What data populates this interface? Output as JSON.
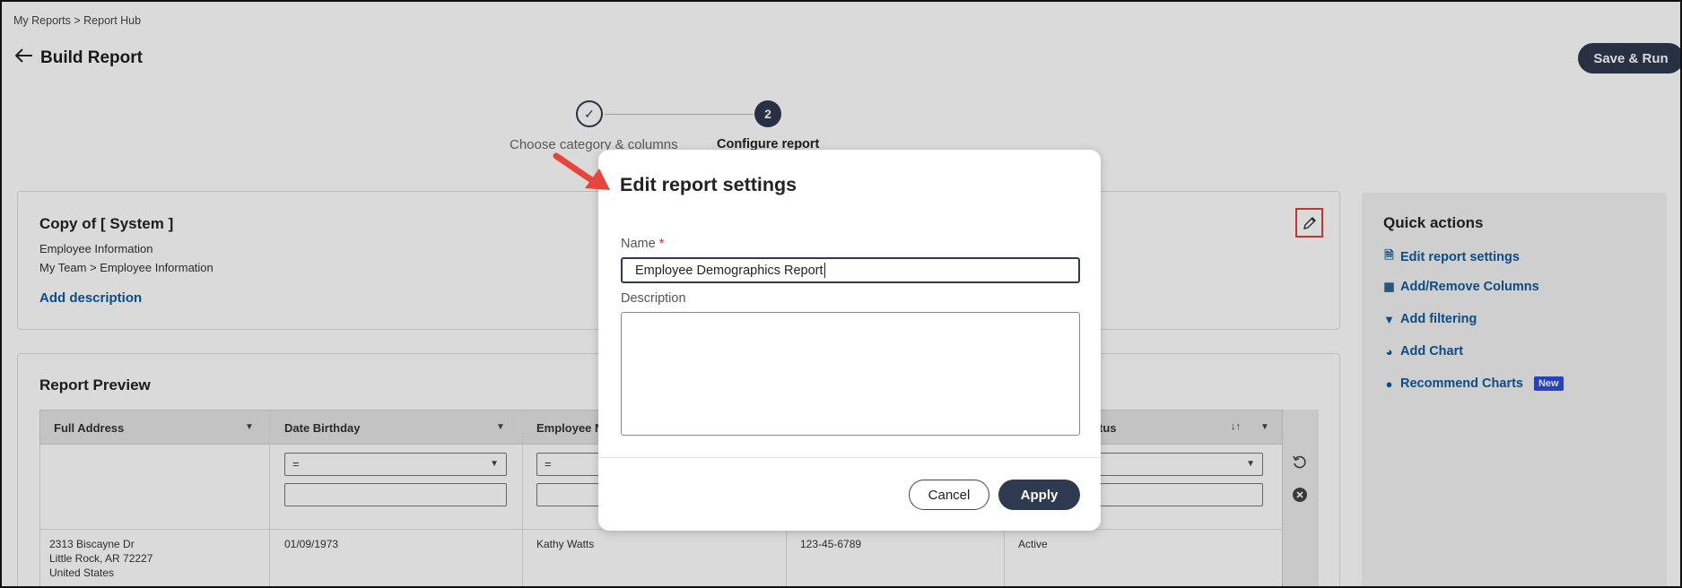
{
  "breadcrumb": "My Reports  >  Report Hub",
  "header": {
    "title": "Build Report",
    "save_run": "Save & Run"
  },
  "stepper": {
    "step1_label": "Choose category & columns",
    "step1_icon": "✓",
    "step2_number": "2",
    "step2_label": "Configure report"
  },
  "report_info": {
    "title": "Copy of [ System ]",
    "category": "Employee Information",
    "path": "My Team > Employee Information",
    "add_description": "Add description"
  },
  "quick_actions": {
    "title": "Quick actions",
    "items": [
      {
        "label": "Edit report settings",
        "icon": "document-icon"
      },
      {
        "label": "Add/Remove Columns",
        "icon": "columns-icon"
      },
      {
        "label": "Add filtering",
        "icon": "filter-icon"
      },
      {
        "label": "Add Chart",
        "icon": "pie-chart-icon"
      },
      {
        "label": "Recommend Charts",
        "icon": "lightbulb-icon",
        "badge": "New"
      }
    ]
  },
  "preview": {
    "title": "Report Preview",
    "columns": [
      "Full Address",
      "Date Birthday",
      "Employee Na",
      "tus"
    ],
    "filter_operator": "=",
    "row": {
      "address_line1": "2313 Biscayne Dr",
      "address_line2": "Little Rock, AR 72227",
      "address_line3": "United States",
      "birthday": "01/09/1973",
      "name": "Kathy Watts",
      "ssn": "123-45-6789",
      "status": "Active"
    },
    "sort_icon": "↓↑"
  },
  "modal": {
    "title": "Edit report settings",
    "name_label": "Name",
    "required_mark": "*",
    "name_value": "Employee Demographics Report",
    "description_label": "Description",
    "cancel": "Cancel",
    "apply": "Apply"
  },
  "colors": {
    "primary_dark": "#2e3a4f",
    "link": "#0f5a9c",
    "highlight_red": "#e0413b",
    "badge": "#2f4fd6"
  }
}
